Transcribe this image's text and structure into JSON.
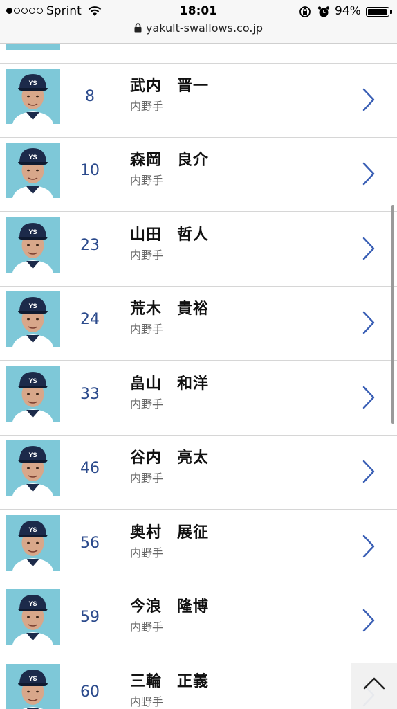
{
  "status": {
    "carrier": "Sprint",
    "time": "18:01",
    "battery": "94%",
    "battery_level": 0.94,
    "signal_filled": 1,
    "signal_total": 5
  },
  "url": "yakult-swallows.co.jp",
  "players": [
    {
      "number": "8",
      "surname": "武内",
      "given": "晋一",
      "position": "内野手"
    },
    {
      "number": "10",
      "surname": "森岡",
      "given": "良介",
      "position": "内野手"
    },
    {
      "number": "23",
      "surname": "山田",
      "given": "哲人",
      "position": "内野手"
    },
    {
      "number": "24",
      "surname": "荒木",
      "given": "貴裕",
      "position": "内野手"
    },
    {
      "number": "33",
      "surname": "畠山",
      "given": "和洋",
      "position": "内野手"
    },
    {
      "number": "46",
      "surname": "谷内",
      "given": "亮太",
      "position": "内野手"
    },
    {
      "number": "56",
      "surname": "奥村",
      "given": "展征",
      "position": "内野手"
    },
    {
      "number": "59",
      "surname": "今浪",
      "given": "隆博",
      "position": "内野手"
    },
    {
      "number": "60",
      "surname": "三輪",
      "given": "正義",
      "position": "内野手"
    }
  ],
  "colors": {
    "accent": "#2b4a8c",
    "chevron": "#3a5fb5",
    "photo_bg": "#7ec8d8",
    "cap": "#1c2a4a"
  },
  "icons": {
    "chevron": "chevron-right-icon",
    "back_to_top": "chevron-up-icon"
  }
}
